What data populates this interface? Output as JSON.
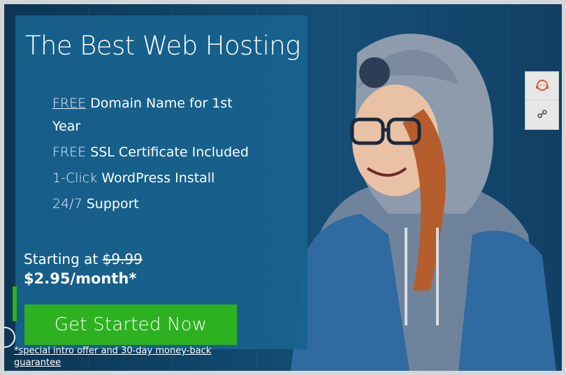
{
  "hero": {
    "headline": "The Best Web Hosting",
    "features": [
      {
        "a": "FREE",
        "b": " Domain Name for 1st Year"
      },
      {
        "a": "FREE ",
        "b": "SSL Certificate Included"
      },
      {
        "a": "1-Click ",
        "b": "WordPress Install"
      },
      {
        "a": "24/7 ",
        "b": "Support"
      }
    ],
    "starting_prefix": "Starting at ",
    "old_price": "$9.99",
    "price": "$2.95/month*",
    "cta_label": "Get Started Now",
    "guarantee_text": "*special intro offer and 30-day money-back guarantee"
  },
  "side_widget": {
    "icons": [
      "support-agent-icon",
      "link-icon"
    ]
  },
  "colors": {
    "panel": "#18638e",
    "cta": "#2db120",
    "background": "#0f3d5e",
    "side_bg": "#e7e7e7",
    "accent_orange": "#e25b2a"
  }
}
